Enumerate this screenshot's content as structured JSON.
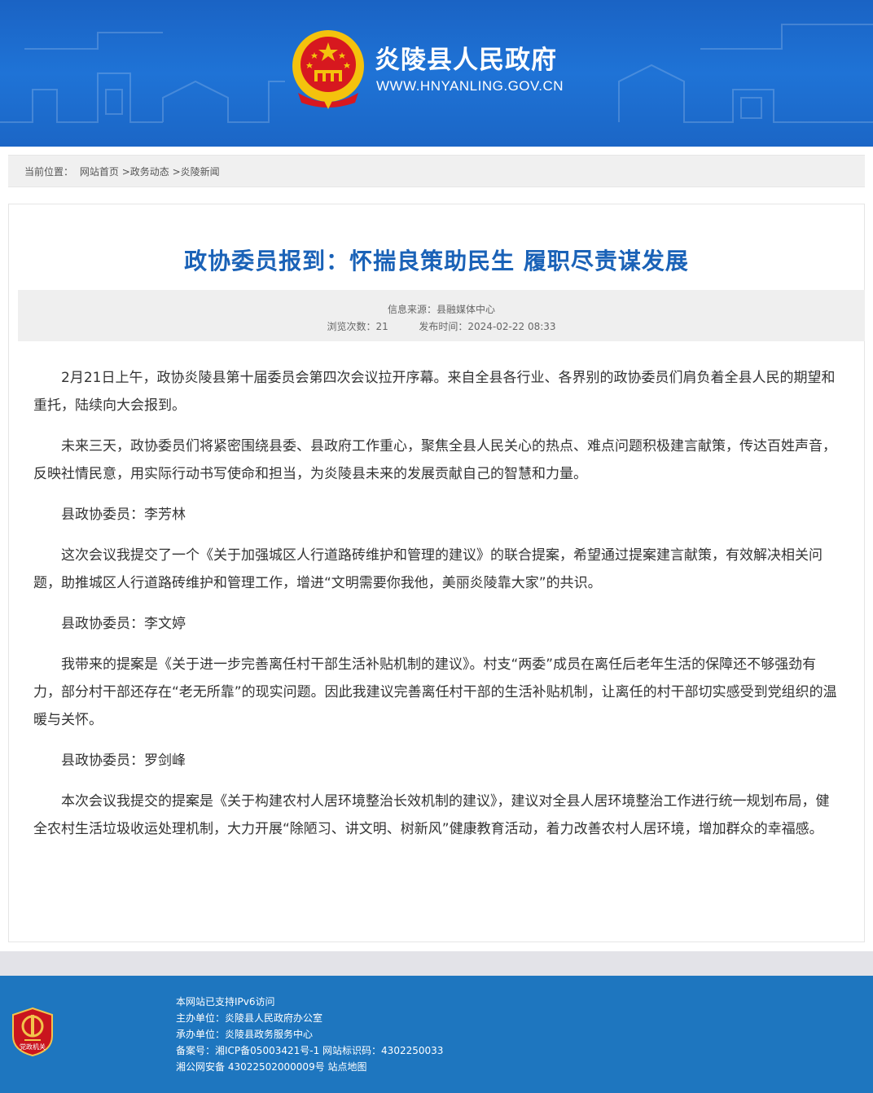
{
  "header": {
    "site_name": "炎陵县人民政府",
    "site_url": "WWW.HNYANLING.GOV.CN",
    "bg_color": "#1f73d6"
  },
  "breadcrumb": {
    "prefix": "当前位置：",
    "items": [
      "网站首页",
      ">政务动态",
      ">炎陵新闻"
    ]
  },
  "article": {
    "title": "政协委员报到：怀揣良策助民生 履职尽责谋发展",
    "source_label": "信息来源：",
    "source": "县融媒体中心",
    "views_label": "浏览次数：",
    "views": "21",
    "published_label": "发布时间：",
    "published": "2024-02-22 08:33",
    "paragraphs": [
      "2月21日上午，政协炎陵县第十届委员会第四次会议拉开序幕。来自全县各行业、各界别的政协委员们肩负着全县人民的期望和重托，陆续向大会报到。",
      "未来三天，政协委员们将紧密围绕县委、县政府工作重心，聚焦全县人民关心的热点、难点问题积极建言献策，传达百姓声音，反映社情民意，用实际行动书写使命和担当，为炎陵县未来的发展贡献自己的智慧和力量。",
      "县政协委员：李芳林",
      "这次会议我提交了一个《关于加强城区人行道路砖维护和管理的建议》的联合提案，希望通过提案建言献策，有效解决相关问题，助推城区人行道路砖维护和管理工作，增进“文明需要你我他，美丽炎陵靠大家”的共识。",
      "县政协委员：李文婷",
      "我带来的提案是《关于进一步完善离任村干部生活补贴机制的建议》。村支“两委”成员在离任后老年生活的保障还不够强劲有力，部分村干部还存在“老无所靠”的现实问题。因此我建议完善离任村干部的生活补贴机制，让离任的村干部切实感受到党组织的温暖与关怀。",
      "县政协委员：罗剑峰",
      "本次会议我提交的提案是《关于构建农村人居环境整治长效机制的建议》，建议对全县人居环境整治工作进行统一规划布局，健全农村生活垃圾收运处理机制，大力开展“除陋习、讲文明、树新风”健康教育活动，着力改善农村人居环境，增加群众的幸福感。"
    ],
    "title_color": "#1a62b7"
  },
  "footer": {
    "ipv6": "本网站已支持IPv6访问",
    "host": "主办单位：炎陵县人民政府办公室",
    "operator": "承办单位：炎陵县政务服务中心",
    "icp_label": "备案号：",
    "icp": "湘ICP备05003421号-1",
    "site_code": "网站标识码：4302250033",
    "police": "湘公网安备 43022502000009号",
    "sitemap": "站点地图",
    "badge_text": "党政机关",
    "bg_color": "#1e76bf"
  }
}
